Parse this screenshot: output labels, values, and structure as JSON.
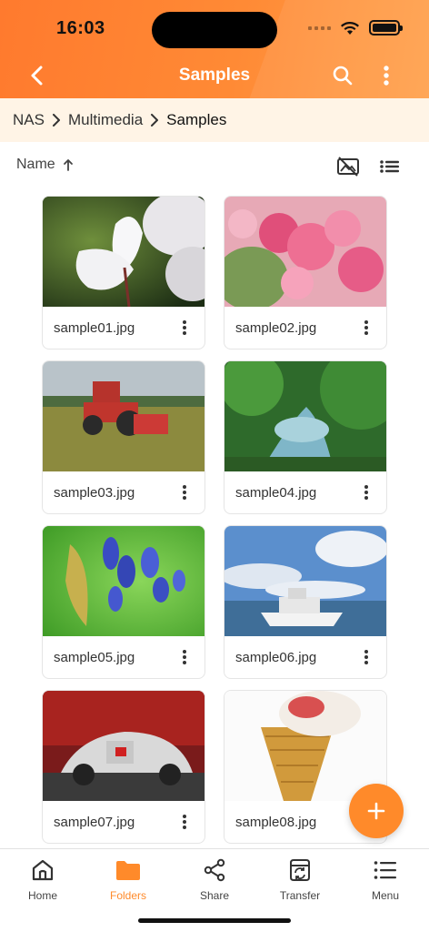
{
  "status_bar": {
    "time": "16:03"
  },
  "header": {
    "title": "Samples",
    "back_icon": "chevron-left-icon",
    "search_icon": "search-icon",
    "more_icon": "more-vertical-icon",
    "gradient_start": "#ff7a2e",
    "gradient_end": "#ffa04a"
  },
  "breadcrumb": {
    "items": [
      "NAS",
      "Multimedia",
      "Samples"
    ]
  },
  "sort": {
    "label": "Name",
    "direction_icon": "arrow-up-icon"
  },
  "files": [
    {
      "name": "sample01.jpg",
      "thumbnail": "white-cyclamen-flower"
    },
    {
      "name": "sample02.jpg",
      "thumbnail": "pink-cherry-blossom"
    },
    {
      "name": "sample03.jpg",
      "thumbnail": "red-tractor-field"
    },
    {
      "name": "sample04.jpg",
      "thumbnail": "river-forest"
    },
    {
      "name": "sample05.jpg",
      "thumbnail": "blue-agapanthus"
    },
    {
      "name": "sample06.jpg",
      "thumbnail": "boat-on-water"
    },
    {
      "name": "sample07.jpg",
      "thumbnail": "silver-race-car"
    },
    {
      "name": "sample08.jpg",
      "thumbnail": "ice-cream-cone"
    }
  ],
  "fab": {
    "icon": "plus-icon",
    "color": "#ff8a2a"
  },
  "bottom_nav": {
    "active": "Folders",
    "accent": "#ff8a2a",
    "tabs": [
      {
        "label": "Home",
        "icon": "home-icon"
      },
      {
        "label": "Folders",
        "icon": "folder-icon"
      },
      {
        "label": "Share",
        "icon": "share-icon"
      },
      {
        "label": "Transfer",
        "icon": "transfer-icon"
      },
      {
        "label": "Menu",
        "icon": "menu-icon"
      }
    ]
  }
}
